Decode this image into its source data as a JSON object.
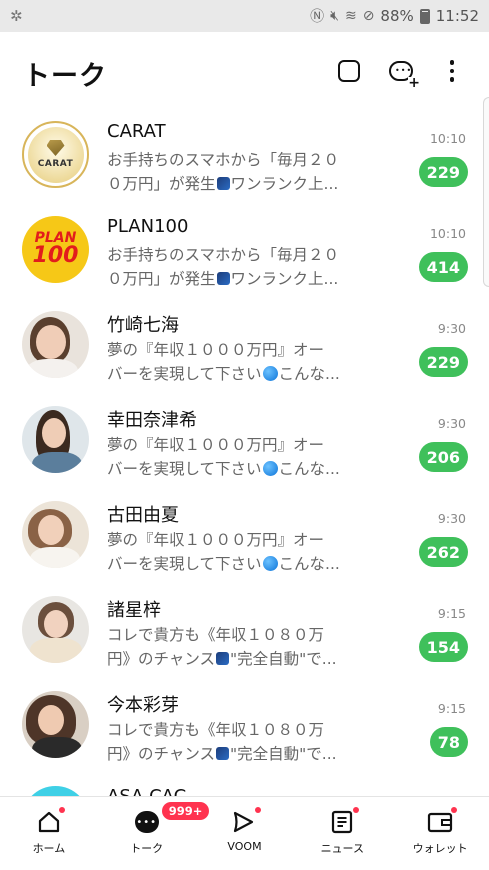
{
  "status_bar": {
    "left_icon": "pinwheel-notification-icon",
    "right_icons": [
      "nfc-icon",
      "mute-icon",
      "wifi-icon",
      "no-signal-icon"
    ],
    "battery_percent": "88%",
    "time": "11:52"
  },
  "header": {
    "title": "トーク",
    "icons": [
      "search-icon",
      "new-chat-icon",
      "more-icon"
    ]
  },
  "chats": [
    {
      "name": "CARAT",
      "preview_a": "お手持ちのスマホから「毎月２０",
      "preview_b": "０万円」が発生",
      "preview_c": "ワンランク上...",
      "time": "10:10",
      "unread": "229",
      "avatar": "carat-logo"
    },
    {
      "name": "PLAN100",
      "preview_a": "お手持ちのスマホから「毎月２０",
      "preview_b": "０万円」が発生",
      "preview_c": "ワンランク上...",
      "time": "10:10",
      "unread": "414",
      "avatar": "plan100-logo",
      "avatar_text": [
        "PLAN",
        "100"
      ]
    },
    {
      "name": "竹崎七海",
      "preview_a": "夢の『年収１０００万円』オー",
      "preview_b": "バーを実現して下さい",
      "preview_c": "こんな...",
      "time": "9:30",
      "unread": "229",
      "avatar": "woman-photo"
    },
    {
      "name": "幸田奈津希",
      "preview_a": "夢の『年収１０００万円』オー",
      "preview_b": "バーを実現して下さい",
      "preview_c": "こんな...",
      "time": "9:30",
      "unread": "206",
      "avatar": "woman-photo"
    },
    {
      "name": "古田由夏",
      "preview_a": "夢の『年収１０００万円』オー",
      "preview_b": "バーを実現して下さい",
      "preview_c": "こんな...",
      "time": "9:30",
      "unread": "262",
      "avatar": "woman-photo"
    },
    {
      "name": "諸星梓",
      "preview_a": "コレで貴方も《年収１０８０万",
      "preview_b": "円》のチャンス",
      "preview_c": "\"完全自動\"で...",
      "time": "9:15",
      "unread": "154",
      "avatar": "woman-photo"
    },
    {
      "name": "今本彩芽",
      "preview_a": "コレで貴方も《年収１０８０万",
      "preview_b": "円》のチャンス",
      "preview_c": "\"完全自動\"で...",
      "time": "9:15",
      "unread": "78",
      "avatar": "woman-photo"
    },
    {
      "name": "ASA CAC",
      "preview_a": "",
      "preview_b": "",
      "preview_c": "",
      "time": "",
      "unread": "",
      "avatar": "partial"
    }
  ],
  "bottom_nav": {
    "home": "ホーム",
    "talk": "トーク",
    "talk_badge": "999+",
    "voom": "VOOM",
    "news": "ニュース",
    "wallet": "ウォレット"
  },
  "colors": {
    "badge_green": "#3fc05b",
    "notification_red": "#ff334f"
  }
}
